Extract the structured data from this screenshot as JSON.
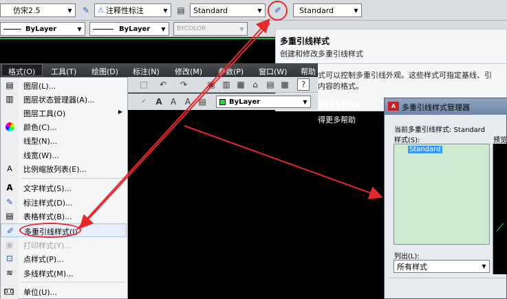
{
  "toolbar": {
    "text_style": "仿宋2.5",
    "annotative": "注释性标注",
    "dim_style": "Standard",
    "mleader_style": "Standard"
  },
  "props": {
    "linetype": "ByLayer",
    "lineweight": "ByLayer",
    "color": "BYCOLOR"
  },
  "tooltip": {
    "title": "多重引线样式",
    "desc": "创建和修改多重引线样式",
    "detail1": "式可以控制多重引线外观。这些样式可指定基线、引",
    "detail2": "内容的格式。",
    "cmd": "DERSTYLE",
    "help": "得更多帮助"
  },
  "menubar": [
    "格式(O)",
    "工具(T)",
    "绘图(D)",
    "标注(N)",
    "修改(M)",
    "参数(P)",
    "窗口(W)",
    "帮助"
  ],
  "toolbar2": {
    "layer": "ByLayer"
  },
  "menu": [
    {
      "label": "图层(L)...",
      "icon": "layers-icon"
    },
    {
      "label": "图层状态管理器(A)...",
      "icon": "layer-state-icon"
    },
    {
      "label": "图层工具(O)",
      "icon": "",
      "submenu": true
    },
    {
      "label": "颜色(C)...",
      "icon": "color-wheel-icon"
    },
    {
      "label": "线型(N)...",
      "icon": ""
    },
    {
      "label": "线宽(W)...",
      "icon": ""
    },
    {
      "label": "比例缩放列表(E)...",
      "icon": "scale-list-icon"
    },
    {
      "label": "文字样式(S)...",
      "icon": "text-style-icon"
    },
    {
      "label": "标注样式(D)...",
      "icon": "dim-style-icon"
    },
    {
      "label": "表格样式(B)...",
      "icon": "table-style-icon"
    },
    {
      "label": "多重引线样式(I)",
      "icon": "mleader-style-icon"
    },
    {
      "label": "打印样式(Y)...",
      "icon": "plot-style-icon",
      "disabled": true
    },
    {
      "label": "点样式(P)...",
      "icon": "point-style-icon"
    },
    {
      "label": "多线样式(M)...",
      "icon": "mline-style-icon"
    },
    {
      "label": "单位(U)...",
      "icon": "units-icon"
    }
  ],
  "dialog": {
    "title": "多重引线样式管理器",
    "current_label": "当前多重引线样式: Standard",
    "styles_label": "样式(S):",
    "preview_label": "预览",
    "style_item": "Standard",
    "list_label": "列出(L):",
    "list_value": "所有样式"
  },
  "colors": {
    "annotation": "#e8272d",
    "list_bg": "#cfe8d0",
    "selection": "#3399ff"
  }
}
